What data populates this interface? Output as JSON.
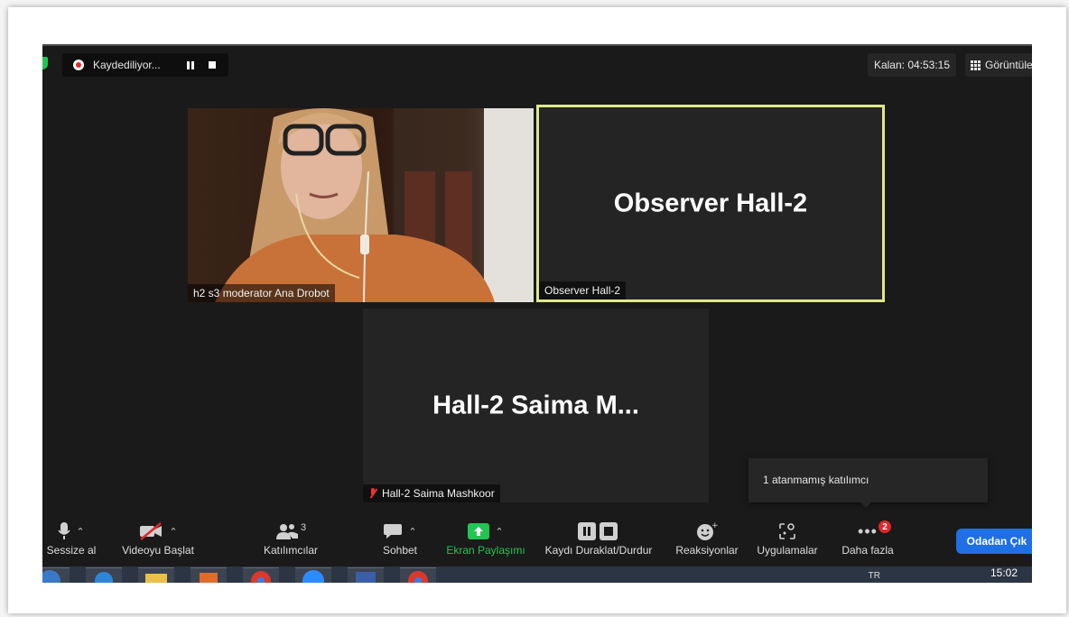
{
  "top_bar": {
    "recording_label": "Kaydediliyor...",
    "remaining_label": "Kalan: 04:53:15",
    "view_label": "Görüntüle"
  },
  "tiles": [
    {
      "name": "h2 s3 moderator Ana Drobot",
      "big_label": ""
    },
    {
      "name": "Observer Hall-2",
      "big_label": "Observer Hall-2"
    },
    {
      "name": "Hall-2 Saima Mashkoor",
      "big_label": "Hall-2  Saima  M..."
    }
  ],
  "tooltip": {
    "text": "1 atanmamış katılımcı"
  },
  "toolbar": {
    "mute": "Sessize al",
    "video": "Videoyu Başlat",
    "participants": "Katılımcılar",
    "participants_count": "3",
    "chat": "Sohbet",
    "share": "Ekran Paylaşımı",
    "record": "Kaydı Duraklat/Durdur",
    "reactions": "Reaksiyonlar",
    "apps": "Uygulamalar",
    "more": "Daha fazla",
    "more_badge": "2",
    "leave": "Odadan Çık"
  },
  "taskbar": {
    "lang": "TR",
    "time": "15:02"
  },
  "colors": {
    "share_green": "#23c552",
    "leave_blue": "#1f6fe5",
    "active_border": "#dfe88a",
    "badge_red": "#e02828"
  }
}
